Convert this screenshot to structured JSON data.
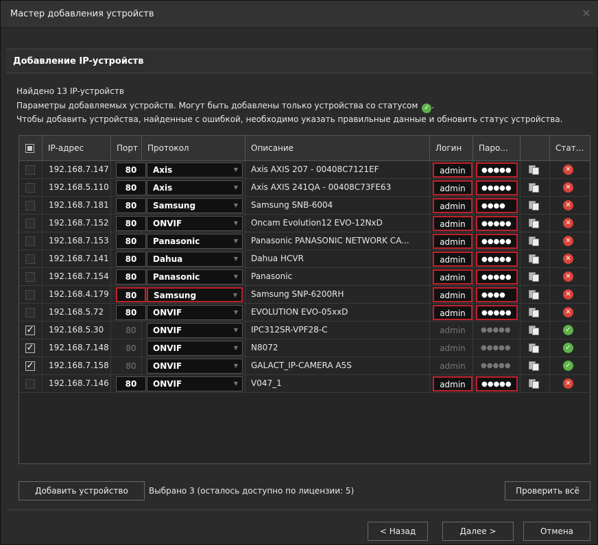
{
  "window": {
    "title": "Мастер добавления устройств",
    "close_icon": "close-icon"
  },
  "section_title": "Добавление IP-устройств",
  "info": {
    "found": "Найдено 13 IP-устройств",
    "line2": "Параметры добавляемых устройств. Могут быть добавлены только устройства со статусом",
    "line2_end": ".",
    "line3": "Чтобы добавить устройства, найденные с ошибкой, необходимо указать правильные данные и обновить статус устройства."
  },
  "table": {
    "headers": {
      "ip": "IP-адрес",
      "port": "Порт",
      "protocol": "Протокол",
      "description": "Описание",
      "login": "Логин",
      "password": "Паро...",
      "status": "Стат..."
    },
    "rows": [
      {
        "checked": false,
        "ip": "192.168.7.147",
        "port": "80",
        "protocol": "Axis",
        "description": "Axis AXIS 207 - 00408C7121EF",
        "login": "admin",
        "password": "●●●●●",
        "status": "error",
        "highlight": [
          "login",
          "password"
        ]
      },
      {
        "checked": false,
        "ip": "192.168.5.110",
        "port": "80",
        "protocol": "Axis",
        "description": "Axis AXIS 241QA - 00408C73FE63",
        "login": "admin",
        "password": "●●●●●",
        "status": "error",
        "highlight": [
          "login",
          "password"
        ]
      },
      {
        "checked": false,
        "ip": "192.168.7.181",
        "port": "80",
        "protocol": "Samsung",
        "description": "Samsung SNB-6004",
        "login": "admin",
        "password": "●●●●",
        "status": "error",
        "highlight": [
          "login",
          "password"
        ]
      },
      {
        "checked": false,
        "ip": "192.168.7.152",
        "port": "80",
        "protocol": "ONVIF",
        "description": "Oncam Evolution12 EVO-12NxD",
        "login": "admin",
        "password": "●●●●●",
        "status": "error",
        "highlight": [
          "login",
          "password"
        ]
      },
      {
        "checked": false,
        "ip": "192.168.7.153",
        "port": "80",
        "protocol": "Panasonic",
        "description": "Panasonic PANASONIC NETWORK CA...",
        "login": "admin",
        "password": "●●●●●",
        "status": "error",
        "highlight": [
          "login",
          "password"
        ]
      },
      {
        "checked": false,
        "ip": "192.168.7.141",
        "port": "80",
        "protocol": "Dahua",
        "description": "Dahua HCVR",
        "login": "admin",
        "password": "●●●●●",
        "status": "error",
        "highlight": [
          "login",
          "password"
        ]
      },
      {
        "checked": false,
        "ip": "192.168.7.154",
        "port": "80",
        "protocol": "Panasonic",
        "description": "Panasonic",
        "login": "admin",
        "password": "●●●●●",
        "status": "error",
        "highlight": [
          "login",
          "password"
        ]
      },
      {
        "checked": false,
        "ip": "192.168.4.179",
        "port": "80",
        "protocol": "Samsung",
        "description": "Samsung SNP-6200RH",
        "login": "admin",
        "password": "●●●●",
        "status": "error",
        "highlight": [
          "port",
          "protocol",
          "login",
          "password"
        ]
      },
      {
        "checked": false,
        "ip": "192.168.5.72",
        "port": "80",
        "protocol": "ONVIF",
        "description": "EVOLUTION EVO-05xxD",
        "login": "admin",
        "password": "●●●●●",
        "status": "error",
        "highlight": [
          "login",
          "password"
        ]
      },
      {
        "checked": true,
        "ip": "192.168.5.30",
        "port": "80",
        "protocol": "ONVIF",
        "description": "IPC312SR-VPF28-C",
        "login": "admin",
        "password": "●●●●●",
        "status": "ok",
        "highlight": []
      },
      {
        "checked": true,
        "ip": "192.168.7.148",
        "port": "80",
        "protocol": "ONVIF",
        "description": "N8072",
        "login": "admin",
        "password": "●●●●●",
        "status": "ok",
        "highlight": []
      },
      {
        "checked": true,
        "ip": "192.168.7.158",
        "port": "80",
        "protocol": "ONVIF",
        "description": "GALACT_IP-CAMERA A5S",
        "login": "admin",
        "password": "●●●●●",
        "status": "ok",
        "highlight": []
      },
      {
        "checked": false,
        "ip": "192.168.7.146",
        "port": "80",
        "protocol": "ONVIF",
        "description": "V047_1",
        "login": "admin",
        "password": "●●●●●",
        "status": "error",
        "highlight": [
          "login",
          "password"
        ]
      }
    ]
  },
  "buttons": {
    "add_device": "Добавить устройство",
    "check_all": "Проверить всё",
    "back": "< Назад",
    "next": "Далее >",
    "cancel": "Отмена"
  },
  "selection_text": "Выбрано 3 (осталось доступно по лицензии: 5)",
  "colors": {
    "background": "#2b2b2b",
    "highlight_border": "#c0202a",
    "status_ok": "#5db34a",
    "status_error": "#d9453a"
  }
}
